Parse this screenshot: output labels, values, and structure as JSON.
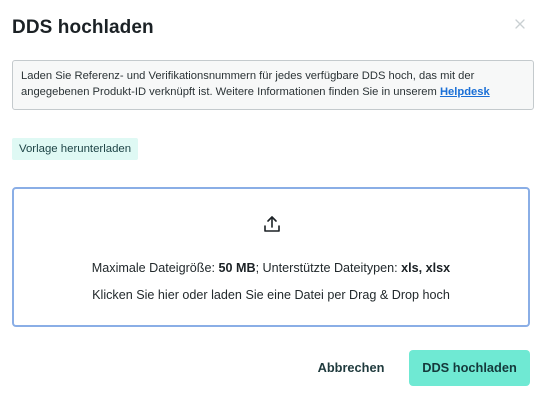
{
  "modal": {
    "title": "DDS hochladen",
    "close_icon": "close-icon"
  },
  "info": {
    "text": "Laden Sie Referenz- und Verifikationsnummern für jedes verfügbare DDS hoch, das mit der angegebenen Produkt-ID verknüpft ist. Weitere Informationen finden Sie in unserem ",
    "link_label": "Helpdesk",
    "link_color": "#1a6fd6"
  },
  "template_button": {
    "label": "Vorlage herunterladen"
  },
  "dropzone": {
    "icon": "upload-icon",
    "size_prefix": "Maximale Dateigröße: ",
    "size_value": "50 MB",
    "types_prefix": "; Unterstützte Dateitypen: ",
    "types_value": "xls, xlsx",
    "hint": "Klicken Sie hier oder laden Sie eine Datei per Drag & Drop hoch",
    "border_color": "#8aaee6"
  },
  "footer": {
    "cancel_label": "Abbrechen",
    "submit_label": "DDS hochladen",
    "submit_color": "#6fe9d3"
  }
}
